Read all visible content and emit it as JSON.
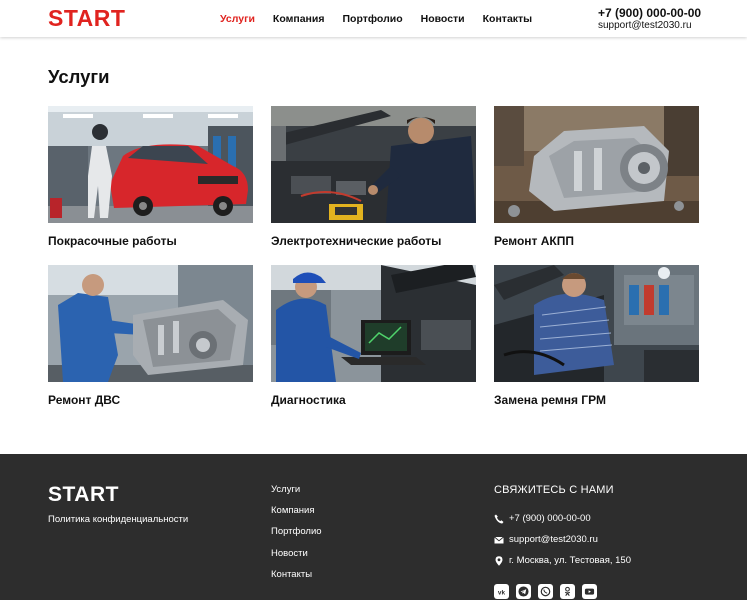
{
  "header": {
    "logo": "START",
    "nav": [
      "Услуги",
      "Компания",
      "Портфолио",
      "Новости",
      "Контакты"
    ],
    "phone": "+7 (900) 000-00-00",
    "email": "support@test2030.ru"
  },
  "main": {
    "title": "Услуги",
    "services": [
      {
        "title": "Покрасочные работы"
      },
      {
        "title": "Электротехнические работы"
      },
      {
        "title": "Ремонт АКПП"
      },
      {
        "title": "Ремонт ДВС"
      },
      {
        "title": "Диагностика"
      },
      {
        "title": "Замена ремня ГРМ"
      }
    ]
  },
  "footer": {
    "logo": "START",
    "privacy": "Политика конфиденциальности",
    "nav": [
      "Услуги",
      "Компания",
      "Портфолио",
      "Новости",
      "Контакты"
    ],
    "contact_title": "СВЯЖИТЕСЬ С НАМИ",
    "phone": "+7 (900) 000-00-00",
    "email": "support@test2030.ru",
    "address": "г. Москва, ул. Тестовая, 150",
    "social_icons": [
      "vk-icon",
      "telegram-icon",
      "whatsapp-icon",
      "odnoklassniki-icon",
      "youtube-icon"
    ]
  },
  "colors": {
    "accent": "#e0231f",
    "footer_bg": "#2d2d2d"
  }
}
